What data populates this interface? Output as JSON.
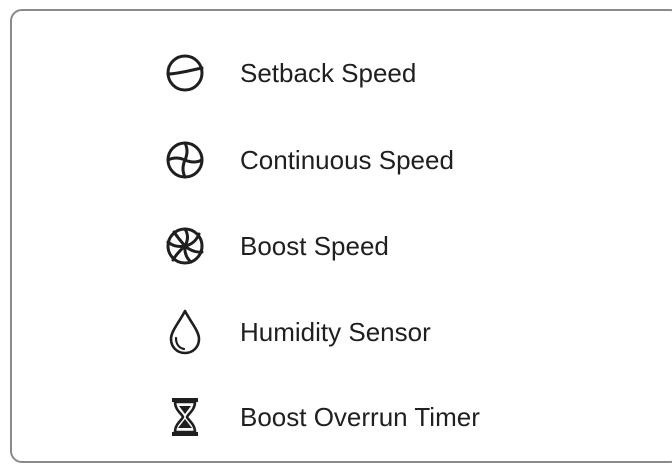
{
  "legend": {
    "items": [
      {
        "icon": "setback-speed-icon",
        "label": "Setback Speed"
      },
      {
        "icon": "continuous-speed-icon",
        "label": "Continuous Speed"
      },
      {
        "icon": "boost-speed-icon",
        "label": "Boost Speed"
      },
      {
        "icon": "humidity-drop-icon",
        "label": "Humidity Sensor"
      },
      {
        "icon": "hourglass-icon",
        "label": "Boost Overrun Timer"
      }
    ],
    "colors": {
      "border": "#8a8a8a",
      "icon": "#1f1f1f",
      "text": "#1f1f1f",
      "background": "#ffffff"
    }
  }
}
